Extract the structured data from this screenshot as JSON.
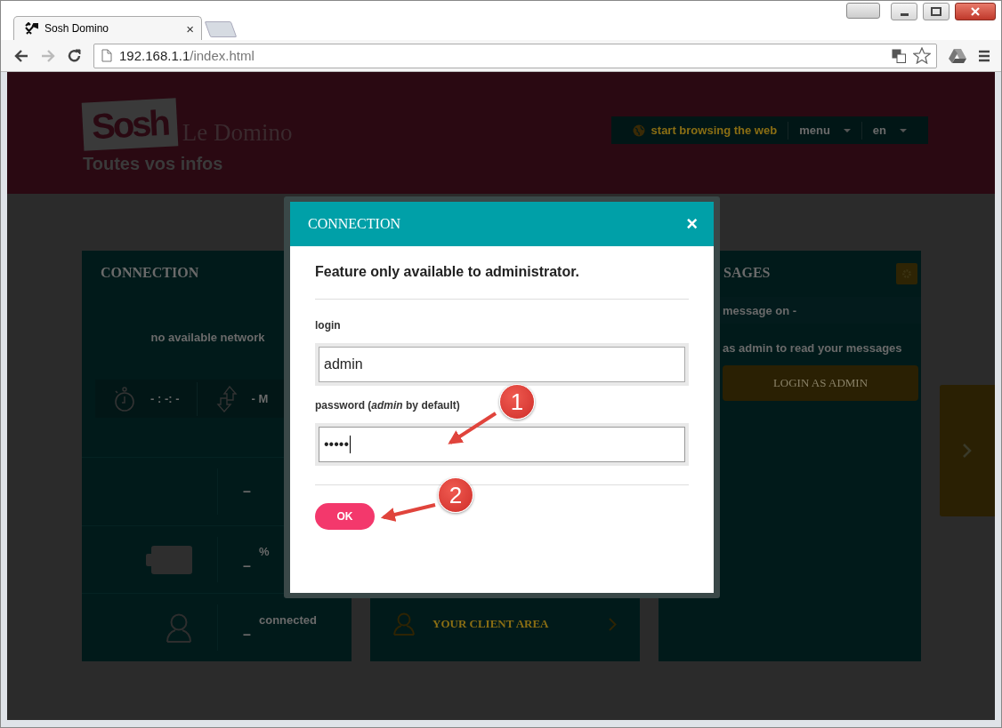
{
  "browser": {
    "tabs": [
      {
        "title": "Sosh Domino",
        "close": "×",
        "selected": true
      }
    ],
    "nav_buttons": [
      {
        "kind": "back",
        "disabled": false
      },
      {
        "kind": "forward",
        "disabled": true
      },
      {
        "kind": "reload",
        "disabled": false
      }
    ],
    "address": {
      "host": "192.168.1.1",
      "path": "/index.html"
    }
  },
  "header": {
    "logo": "Sosh",
    "name": "Le Domino",
    "tagline": "Toutes vos infos",
    "nav": [
      {
        "kind": "web",
        "label": "start browsing the web"
      },
      {
        "kind": "dropdown",
        "label": "menu"
      },
      {
        "kind": "dropdown",
        "label": "en"
      }
    ]
  },
  "connection_card": {
    "title": "CONNECTION",
    "status": "no available network",
    "stats": [
      {
        "kind": "timer",
        "value": "- : -: -"
      },
      {
        "kind": "transfer",
        "value": "- M"
      }
    ],
    "rows": [
      {
        "kind": "plain",
        "value": "–"
      },
      {
        "kind": "battery",
        "label": "%",
        "value": "–"
      },
      {
        "kind": "user",
        "label": "connected",
        "value": "–"
      }
    ]
  },
  "client_area": {
    "label": "YOUR CLIENT AREA"
  },
  "messages_card": {
    "title": "SAGES",
    "subheader": "message on -",
    "text": "as admin to read your messages",
    "button": "LOGIN AS ADMIN"
  },
  "modal": {
    "title": "CONNECTION",
    "close": "×",
    "message": "Feature only available to administrator.",
    "fields": [
      {
        "label": "login",
        "value": "admin",
        "focused": false
      },
      {
        "label": "password (*admin* by default)",
        "value": "•••••",
        "focused": true
      }
    ],
    "button": "OK"
  },
  "annotations": [
    {
      "number": "1"
    },
    {
      "number": "2"
    }
  ]
}
